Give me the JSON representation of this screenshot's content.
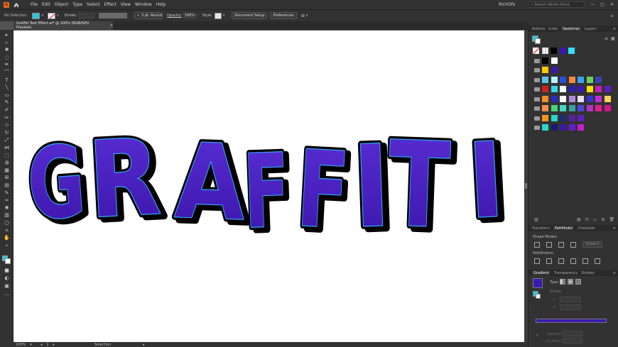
{
  "menubar": {
    "items": [
      "File",
      "Edit",
      "Object",
      "Type",
      "Select",
      "Effect",
      "View",
      "Window",
      "Help"
    ],
    "user": "RichGfx",
    "search_placeholder": "Search Adobe Stock"
  },
  "control": {
    "selection_label": "No Selection",
    "stroke_label": "Stroke:",
    "brush_label": "3 pt. Round",
    "opacity_label": "Opacity:",
    "opacity_value": "100%",
    "style_label": "Style:",
    "doc_setup": "Document Setup",
    "preferences": "Preferences"
  },
  "document": {
    "tab_title": "Graffiti Text Effect.ai* @ 100% (RGB/GPU Preview)",
    "close": "×"
  },
  "artwork": {
    "text": "GRAFFITI",
    "fill": "#4a1fbf",
    "outline": "#2fa8ff",
    "shadow": "#000000"
  },
  "status": {
    "zoom": "100%",
    "page": "1",
    "tool": "Selection"
  },
  "panel_top_tabs": [
    "Actions",
    "Links",
    "Swatches",
    "Layers"
  ],
  "swatches": {
    "rows": [
      [
        "#ffffff",
        "#ffffff",
        "#000000",
        "#3a1ab0",
        "#33e0ff"
      ],
      [
        "#000000",
        "#ffffff"
      ],
      [
        "#ffcc00",
        "#3a1ab0"
      ],
      [
        "#5fc1e8",
        "#b7f5ff",
        "#2f4ddd",
        "#f28c3a",
        "#3ba3f1",
        "#6ad25c",
        "#3c42b5"
      ],
      [
        "#d41d1d",
        "#37d6e5",
        "#ffffff",
        "#2a1fb0",
        "#3a1ab0",
        "#f5e300",
        "#c41fbf",
        "#5e1eb8"
      ],
      [
        "#f28c28",
        "#2a2ac0",
        "#ffffff",
        "#b08ad9",
        "#e6dff7",
        "#3a33d6",
        "#bd2fd6",
        "#ffd35a"
      ],
      [
        "#ff8c4a",
        "#46d67a",
        "#4ad6c0",
        "#3aa0a0",
        "#4a4ad0",
        "#b033c0",
        "#e01f8f",
        "#d6148a"
      ],
      [
        "#f7941d",
        "#2ad6c9",
        "#1f2a70",
        "#5a1fa0",
        "#5e1fc0"
      ],
      [
        "#2ad6c9",
        "#1a1a70",
        "#3a1aa0",
        "#6a1ad0",
        "#c41fcf"
      ]
    ]
  },
  "panel_mid_tabs": [
    "Transform",
    "Pathfinder",
    "Character"
  ],
  "pathfinder": {
    "shape_modes": "Shape Modes:",
    "expand": "Expand",
    "pathfinders": "Pathfinders:"
  },
  "panel_grad_tabs": [
    "Gradient",
    "Transparency",
    "Strokes"
  ],
  "gradient": {
    "type_label": "Type:",
    "stroke_label": "Stroke:",
    "bar_color": "#3a1ab0",
    "opacity_label": "Opacity:",
    "location_label": "Location:"
  },
  "colors": {
    "accent": "#31c6d8",
    "artboard": "#ffffff"
  }
}
